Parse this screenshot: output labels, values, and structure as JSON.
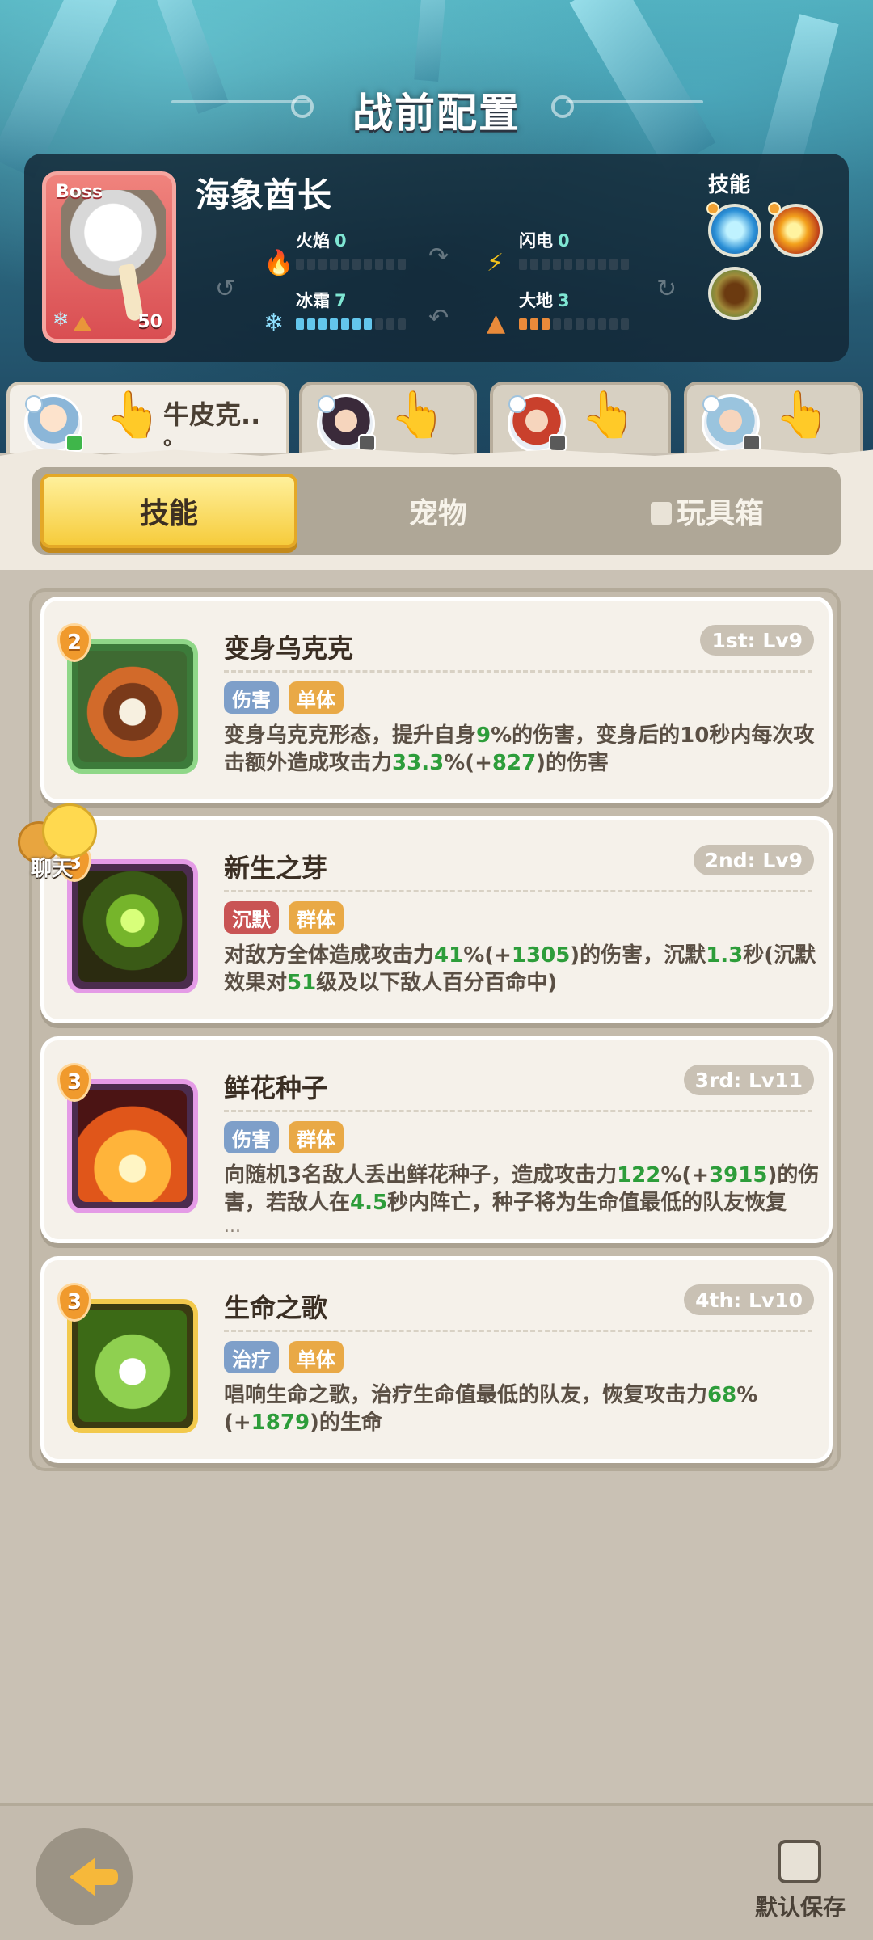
{
  "header": {
    "title": "战前配置"
  },
  "boss": {
    "tag": "Boss",
    "name": "海象酋长",
    "level": "50",
    "stats": [
      {
        "name": "火焰",
        "value": "0",
        "fill": 0
      },
      {
        "name": "闪电",
        "value": "0",
        "fill": 0
      },
      {
        "name": "冰霜",
        "value": "7",
        "fill": 7
      },
      {
        "name": "大地",
        "value": "3",
        "fill": 3
      }
    ],
    "skills_label": "技能",
    "skill_orbs": [
      "ice-orb-icon",
      "fire-orb-icon",
      "earth-orb-icon"
    ]
  },
  "heroes": [
    {
      "name": "牛皮克..",
      "name_line2": "。",
      "active": true
    },
    {
      "name": "",
      "active": false
    },
    {
      "name": "",
      "active": false
    },
    {
      "name": "",
      "active": false
    }
  ],
  "tabs": [
    "技能",
    "宠物",
    "玩具箱"
  ],
  "skills": [
    {
      "title": "变身乌克克",
      "rank": "1st: Lv9",
      "level": "2",
      "tags": [
        "伤害",
        "单体"
      ],
      "desc_parts": [
        "变身乌克克形态，提升自身",
        "9",
        "%的伤害，变身后的10秒内每次攻击额外造成攻击力",
        "33.3",
        "%(+",
        "827",
        ")的伤害"
      ]
    },
    {
      "title": "新生之芽",
      "rank": "2nd: Lv9",
      "level": "3",
      "tags": [
        "沉默",
        "群体"
      ],
      "desc_parts": [
        "对敌方全体造成攻击力",
        "41",
        "%(+",
        "1305",
        ")的伤害，沉默",
        "1.3",
        "秒(沉默效果对",
        "51",
        "级及以下敌人百分百命中)"
      ]
    },
    {
      "title": "鲜花种子",
      "rank": "3rd: Lv11",
      "level": "3",
      "tags": [
        "伤害",
        "群体"
      ],
      "desc_parts": [
        "向随机3名敌人丢出鲜花种子，造成攻击力",
        "122",
        "%(+",
        "3915",
        ")的伤害，若敌人在",
        "4.5",
        "秒内阵亡，种子将为生命值最低的队友恢复"
      ],
      "ellipsis": "..."
    },
    {
      "title": "生命之歌",
      "rank": "4th: Lv10",
      "level": "3",
      "tags": [
        "治疗",
        "单体"
      ],
      "desc_parts": [
        "唱响生命之歌，治疗生命值最低的队友，恢复攻击力",
        "68",
        "%(+",
        "1879",
        ")的生命"
      ]
    }
  ],
  "chat": {
    "label": "聊天"
  },
  "footer": {
    "save_label": "默认保存",
    "save_checked": false
  },
  "colors": {
    "accent_yellow": "#f6cc3c",
    "highlight_green": "#2d9d3a",
    "boss_red": "#d94e52"
  }
}
